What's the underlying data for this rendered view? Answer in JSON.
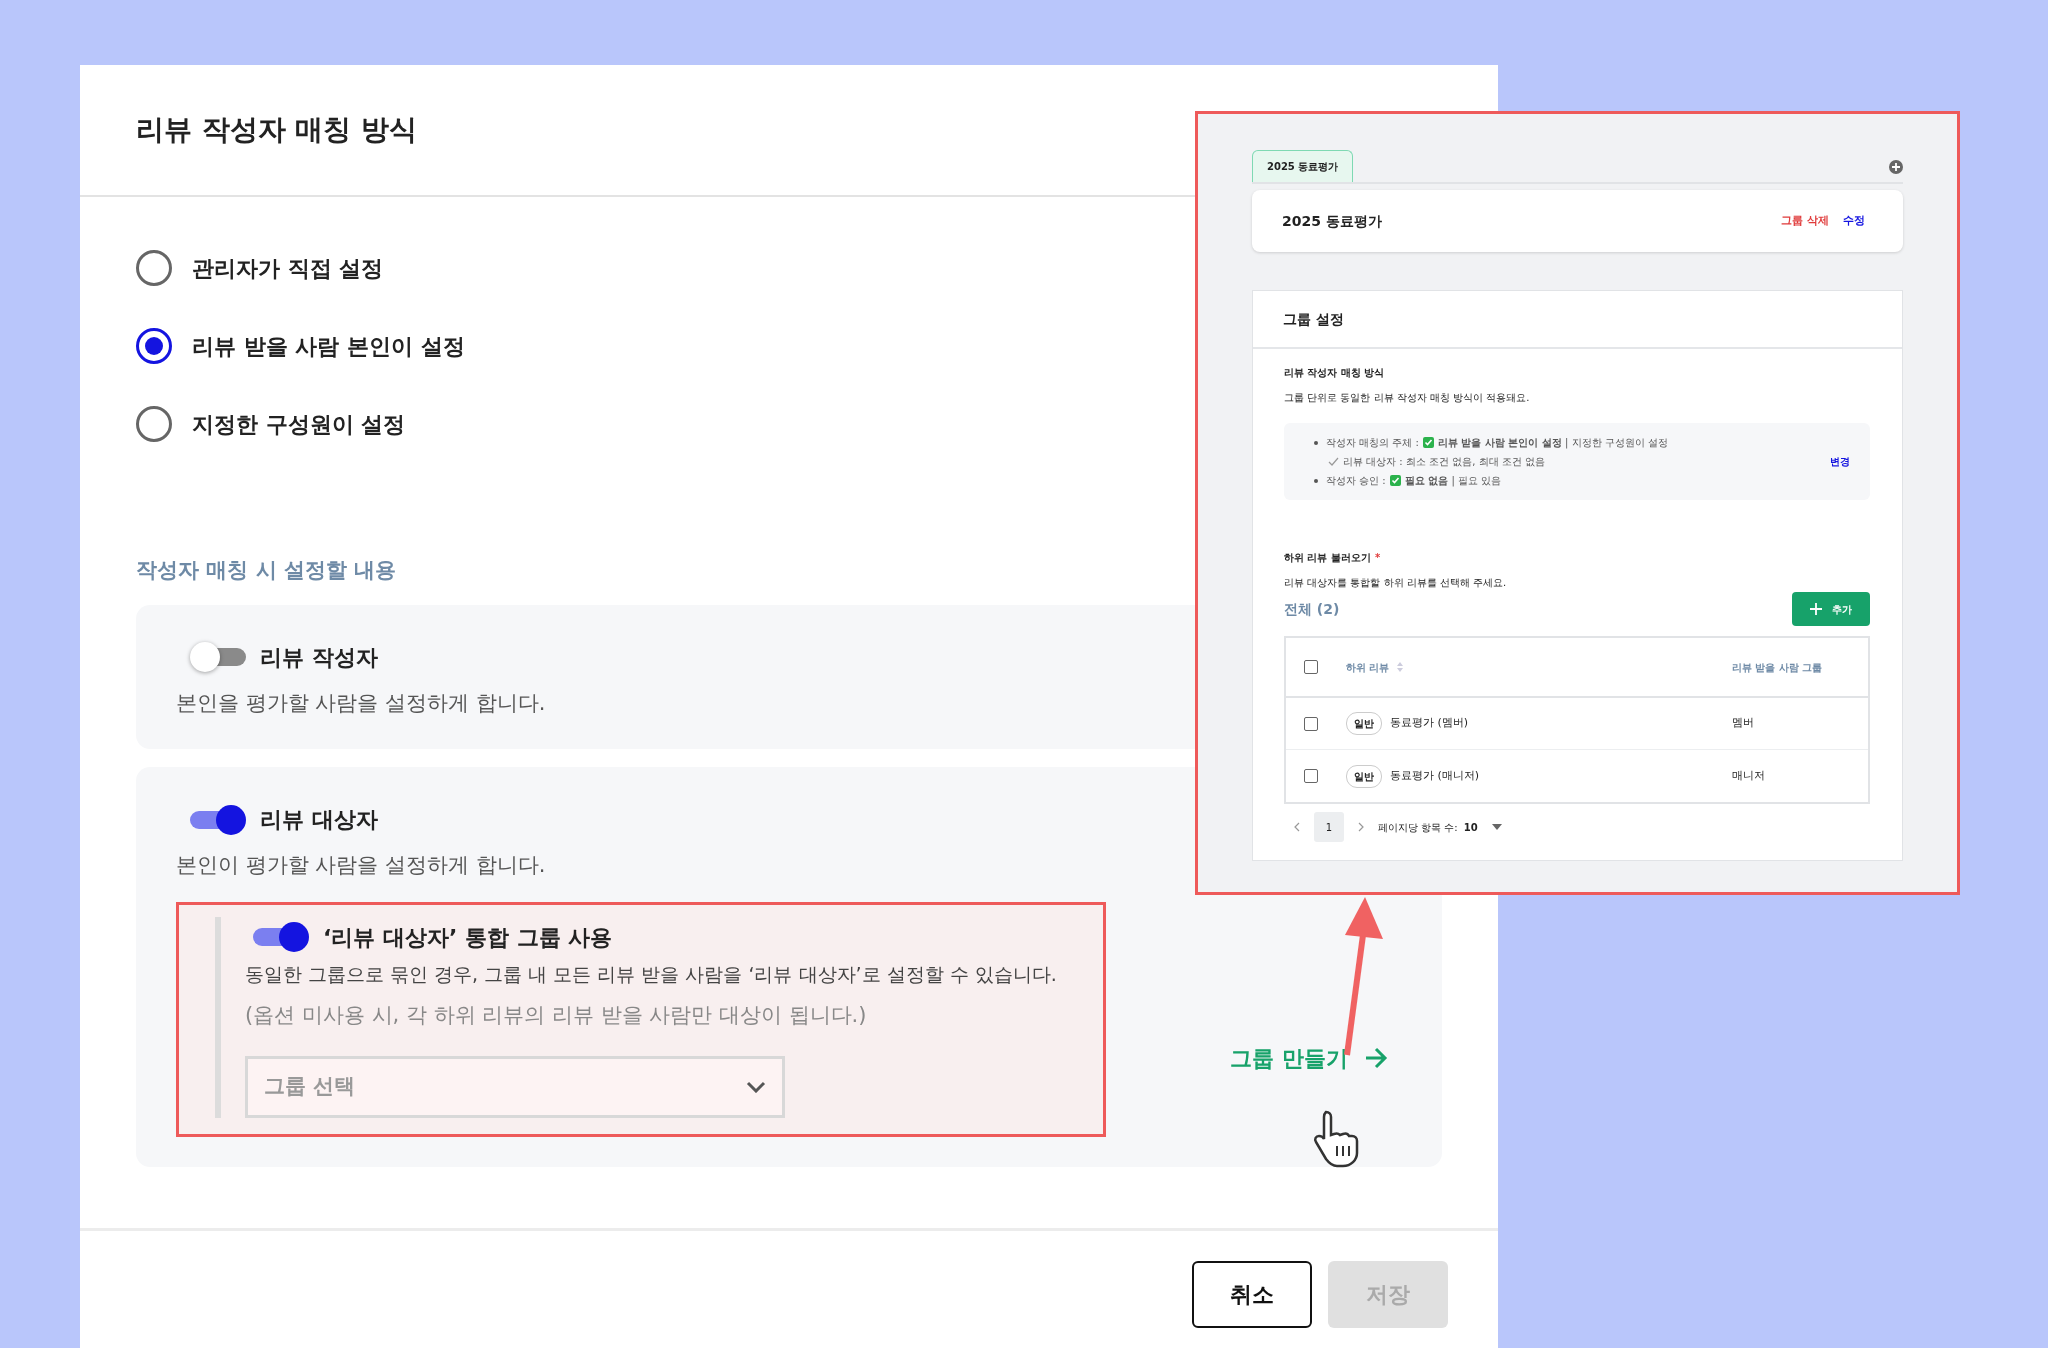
{
  "dialog": {
    "title": "리뷰 작성자 매칭 방식",
    "options": [
      {
        "label": "관리자가 직접 설정",
        "selected": false
      },
      {
        "label": "리뷰 받을 사람 본인이 설정",
        "selected": true
      },
      {
        "label": "지정한 구성원이 설정",
        "selected": false
      }
    ],
    "section_title": "작성자 매칭 시 설정할 내용",
    "settings": [
      {
        "title": "리뷰 작성자",
        "description": "본인을 평가할 사람을 설정하게 합니다.",
        "on": false
      },
      {
        "title": "리뷰 대상자",
        "description": "본인이 평가할 사람을 설정하게 합니다.",
        "on": true,
        "group_option": {
          "title": "‘리뷰 대상자’ 통합 그룹 사용",
          "on": true,
          "description": "동일한 그룹으로 묶인 경우, 그룹 내 모든 리뷰 받을 사람을 ‘리뷰 대상자’로 설정할 수 있습니다.",
          "note": "(옵션 미사용 시, 각 하위 리뷰의 리뷰 받을 사람만 대상이 됩니다.)",
          "select": {
            "placeholder": "그룹 선택"
          }
        },
        "link": "그룹 만들기"
      }
    ],
    "buttons": [
      {
        "label": "취소",
        "disabled": false
      },
      {
        "label": "저장",
        "disabled": true
      }
    ]
  },
  "preview": {
    "tabs": [
      {
        "label": "2025 동료평가",
        "selected": true
      }
    ],
    "group_name": "2025 동료평가",
    "actions": [
      {
        "label": "그룹 삭제",
        "kind": "danger"
      },
      {
        "label": "수정",
        "kind": "primary"
      }
    ],
    "settings_title": "그룹 설정",
    "matching": {
      "title": "리뷰 작성자 매칭 방식",
      "description": "그룹 단위로 동일한 리뷰 작성자 매칭 방식이 적용돼요.",
      "lines": [
        {
          "kind": "bullet",
          "label": "작성자 매칭의 주체 :",
          "value": "**리뷰 받을 사람 본인이 설정** | 지정한 구성원이 설정"
        },
        {
          "kind": "check",
          "label": "리뷰 대상자 : 최소 조건 없음, 최대 조건 없음"
        },
        {
          "kind": "bullet",
          "label": "작성자 승인 :",
          "value": "**필요 없음** | 필요 있음"
        }
      ],
      "change_link": "변경"
    },
    "sub_reviews": {
      "title": "하위 리뷰 불러오기",
      "required_mark": "*",
      "select_all_checked": false,
      "description": "리뷰 대상자를 통합할 하위 리뷰를 선택해 주세요.",
      "total": "전체 (2)",
      "add_button": "추가",
      "columns": [
        "하위 리뷰",
        "리뷰 받을 사람 그룹"
      ],
      "rows": [
        {
          "checked": false,
          "tag": "일반",
          "name": "동료평가 (멤버)",
          "group": "멤버"
        },
        {
          "checked": false,
          "tag": "일반",
          "name": "동료평가 (매니저)",
          "group": "매니저"
        }
      ],
      "pages": [
        {
          "label": "1",
          "selected": true
        }
      ],
      "per_page_label": "페이지당 항목 수:",
      "per_page": "10"
    }
  }
}
